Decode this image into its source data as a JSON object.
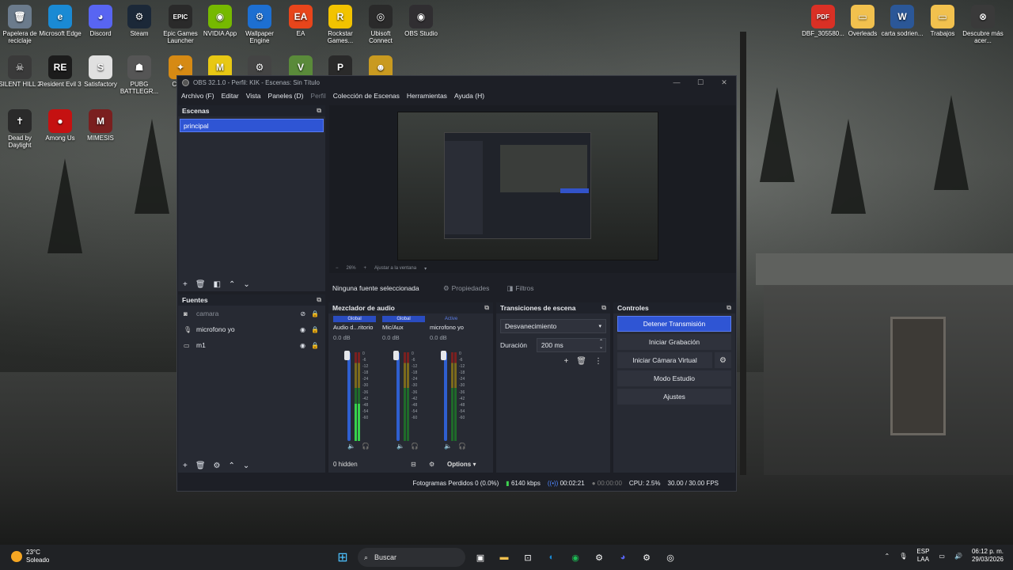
{
  "desktop": {
    "icons": [
      {
        "label": "Papelera de reciclaje",
        "glyph": "🗑",
        "color": "#6b7b8c"
      },
      {
        "label": "Microsoft Edge",
        "glyph": "e",
        "color": "#1a8ad4"
      },
      {
        "label": "Discord",
        "glyph": "◕",
        "color": "#5865f2"
      },
      {
        "label": "Steam",
        "glyph": "⚙",
        "color": "#1b2838"
      },
      {
        "label": "Epic Games Launcher",
        "glyph": "EPIC",
        "color": "#2a2a2a"
      },
      {
        "label": "NVIDIA App",
        "glyph": "◉",
        "color": "#76b900"
      },
      {
        "label": "Wallpaper Engine",
        "glyph": "⚙",
        "color": "#1d6fd1"
      },
      {
        "label": "EA",
        "glyph": "EA",
        "color": "#e8451b"
      },
      {
        "label": "Rockstar Games...",
        "glyph": "R",
        "color": "#f2c300"
      },
      {
        "label": "Ubisoft Connect",
        "glyph": "◎",
        "color": "#2a2a2a"
      },
      {
        "label": "OBS Studio",
        "glyph": "◉",
        "color": "#302e31"
      },
      {
        "label": "SILENT HILL 2",
        "glyph": "☠",
        "color": "#3a3a3a"
      },
      {
        "label": "Resident Evil 3",
        "glyph": "RE",
        "color": "#1c1c1c"
      },
      {
        "label": "Satisfactory",
        "glyph": "S",
        "color": "#e0e0e0"
      },
      {
        "label": "PUBG BATTLEGR...",
        "glyph": "☗",
        "color": "#555555"
      },
      {
        "label": "Cou...",
        "glyph": "✦",
        "color": "#d68a14"
      },
      {
        "label": "",
        "glyph": "M",
        "color": "#e8c814"
      },
      {
        "label": "",
        "glyph": "⚙",
        "color": "#444444"
      },
      {
        "label": "",
        "glyph": "V",
        "color": "#5a8a3a"
      },
      {
        "label": "",
        "glyph": "P",
        "color": "#2a2a2a"
      },
      {
        "label": "",
        "glyph": "☻",
        "color": "#c99a20"
      },
      {
        "label": "Dead by Daylight",
        "glyph": "✝",
        "color": "#2a2a2a"
      },
      {
        "label": "Among Us",
        "glyph": "●",
        "color": "#c51111"
      },
      {
        "label": "MIMESIS",
        "glyph": "M",
        "color": "#7a1f1f"
      },
      {
        "label": "DBF_305580...",
        "glyph": "PDF",
        "color": "#d93025"
      },
      {
        "label": "Overleads",
        "glyph": "▭",
        "color": "#f2c14e"
      },
      {
        "label": "carta sodrien...",
        "glyph": "W",
        "color": "#2b5797"
      },
      {
        "label": "Trabajos",
        "glyph": "▭",
        "color": "#f2c14e"
      },
      {
        "label": "Descubre más acer...",
        "glyph": "⊗",
        "color": "#3a3a3a"
      }
    ]
  },
  "obs": {
    "title": "OBS 32.1.0 - Perfil: KIK - Escenas: Sin Título",
    "menu": [
      "Archivo (F)",
      "Editar",
      "Vista",
      "Paneles (D)",
      "Perfil",
      "Colección de Escenas",
      "Herramientas",
      "Ayuda (H)"
    ],
    "scenes": {
      "header": "Escenas",
      "items": [
        "principal"
      ]
    },
    "sources": {
      "header": "Fuentes",
      "items": [
        {
          "name": "camara",
          "icon": "camera-icon",
          "visible": false,
          "locked": true
        },
        {
          "name": "microfono yo",
          "icon": "microphone-icon",
          "visible": true,
          "locked": true
        },
        {
          "name": "m1",
          "icon": "monitor-icon",
          "visible": true,
          "locked": true
        }
      ]
    },
    "preview": {
      "zoom": "26%",
      "fit_label": "Ajustar a la ventana"
    },
    "context": {
      "no_source": "Ninguna fuente seleccionada",
      "properties": "Propiedades",
      "filters": "Filtros"
    },
    "mixer": {
      "header": "Mezclador de audio",
      "channels": [
        {
          "tag": "Global",
          "name": "Audio d...ritorio",
          "db": "0.0 dB",
          "level": 0.42
        },
        {
          "tag": "Global",
          "name": "Mic/Aux",
          "db": "0.0 dB",
          "level": 0.0
        },
        {
          "tag": "Active",
          "name": "microfono yo",
          "db": "0.0 dB",
          "level": 0.0
        }
      ],
      "scale": [
        "0",
        "-6",
        "-12",
        "-18",
        "-24",
        "-30",
        "-36",
        "-42",
        "-48",
        "-54",
        "-60"
      ],
      "hidden": "0 hidden",
      "options": "Options"
    },
    "transitions": {
      "header": "Transiciones de escena",
      "selected": "Desvanecimiento",
      "duration_label": "Duración",
      "duration_value": "200 ms"
    },
    "controls": {
      "header": "Controles",
      "stop_stream": "Detener Transmisión",
      "start_record": "Iniciar Grabación",
      "start_virtualcam": "Iniciar Cámara Virtual",
      "studio_mode": "Modo Estudio",
      "settings": "Ajustes"
    },
    "status": {
      "dropped": "Fotogramas Perdidos 0 (0.0%)",
      "bitrate": "6140 kbps",
      "stream_time": "00:02:21",
      "record_time": "00:00:00",
      "cpu": "CPU: 2.5%",
      "fps": "30.00 / 30.00 FPS"
    }
  },
  "taskbar": {
    "weather_temp": "23°C",
    "weather_desc": "Soleado",
    "search_placeholder": "Buscar",
    "lang1": "ESP",
    "lang2": "LAA",
    "time": "06:12 p. m.",
    "date": "29/03/2026"
  }
}
